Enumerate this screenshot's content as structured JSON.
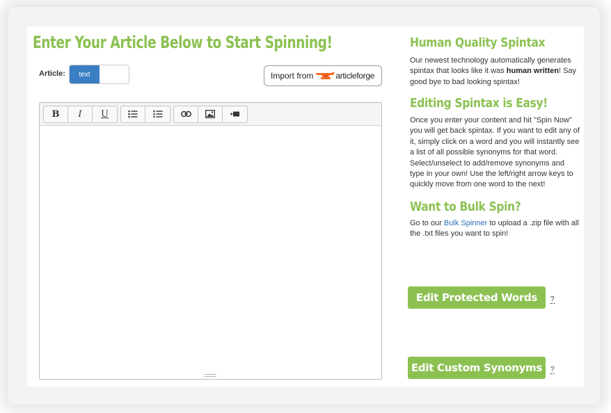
{
  "page": {
    "title": "Enter Your Article Below to Start Spinning!"
  },
  "article": {
    "label": "Article:",
    "mode_selected": "text"
  },
  "import": {
    "prefix": "Import from",
    "brand": "articleforge"
  },
  "editor": {
    "content": "",
    "toolbar": {
      "bold": "B",
      "italic": "I",
      "underline": "U",
      "bullet_list": "bulleted-list-icon",
      "numbered_list": "numbered-list-icon",
      "link": "link-icon",
      "image": "image-icon",
      "video": "video-icon"
    }
  },
  "sidebar": {
    "section1": {
      "heading": "Human Quality Spintax",
      "text_before": "Our newest technology automatically generates spintax that looks like it was ",
      "text_bold": "human written",
      "text_after": "! Say good bye to bad looking spintax!"
    },
    "section2": {
      "heading": "Editing Spintax is Easy!",
      "text": "Once you enter your content and hit \"Spin Now\" you will get back spintax. If you want to edit any of it, simply click on a word and you will instantly see a list of all possible synonyms for that word. Select/unselect to add/remove synonyms and type in your own! Use the left/right arrow keys to quickly move from one word to the next!"
    },
    "section3": {
      "heading": "Want to Bulk Spin?",
      "text_before": "Go to our ",
      "link": "Bulk Spinner",
      "text_after": " to upload a .zip file with all the .txt files you want to spin!"
    }
  },
  "buttons": {
    "protected": "Edit Protected Words",
    "synonyms": "Edit Custom Synonyms",
    "help": "?"
  },
  "colors": {
    "accent_green": "#8cc152",
    "toggle_blue": "#3a7ec3",
    "link_blue": "#2a6ebb",
    "brand_orange": "#f26b21"
  }
}
